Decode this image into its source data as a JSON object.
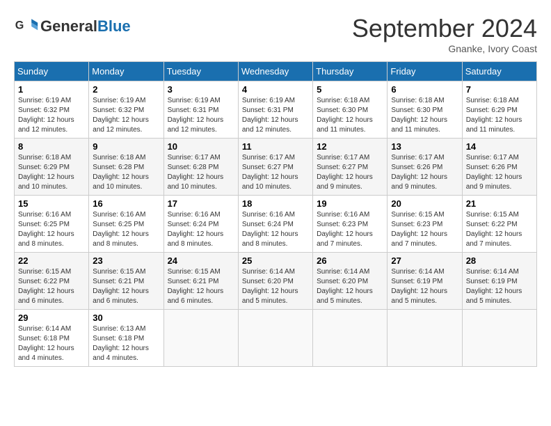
{
  "header": {
    "logo_general": "General",
    "logo_blue": "Blue",
    "month_title": "September 2024",
    "location": "Gnanke, Ivory Coast"
  },
  "days_of_week": [
    "Sunday",
    "Monday",
    "Tuesday",
    "Wednesday",
    "Thursday",
    "Friday",
    "Saturday"
  ],
  "weeks": [
    [
      {
        "day": "1",
        "sunrise": "6:19 AM",
        "sunset": "6:32 PM",
        "daylight": "12 hours and 12 minutes."
      },
      {
        "day": "2",
        "sunrise": "6:19 AM",
        "sunset": "6:32 PM",
        "daylight": "12 hours and 12 minutes."
      },
      {
        "day": "3",
        "sunrise": "6:19 AM",
        "sunset": "6:31 PM",
        "daylight": "12 hours and 12 minutes."
      },
      {
        "day": "4",
        "sunrise": "6:19 AM",
        "sunset": "6:31 PM",
        "daylight": "12 hours and 12 minutes."
      },
      {
        "day": "5",
        "sunrise": "6:18 AM",
        "sunset": "6:30 PM",
        "daylight": "12 hours and 11 minutes."
      },
      {
        "day": "6",
        "sunrise": "6:18 AM",
        "sunset": "6:30 PM",
        "daylight": "12 hours and 11 minutes."
      },
      {
        "day": "7",
        "sunrise": "6:18 AM",
        "sunset": "6:29 PM",
        "daylight": "12 hours and 11 minutes."
      }
    ],
    [
      {
        "day": "8",
        "sunrise": "6:18 AM",
        "sunset": "6:29 PM",
        "daylight": "12 hours and 10 minutes."
      },
      {
        "day": "9",
        "sunrise": "6:18 AM",
        "sunset": "6:28 PM",
        "daylight": "12 hours and 10 minutes."
      },
      {
        "day": "10",
        "sunrise": "6:17 AM",
        "sunset": "6:28 PM",
        "daylight": "12 hours and 10 minutes."
      },
      {
        "day": "11",
        "sunrise": "6:17 AM",
        "sunset": "6:27 PM",
        "daylight": "12 hours and 10 minutes."
      },
      {
        "day": "12",
        "sunrise": "6:17 AM",
        "sunset": "6:27 PM",
        "daylight": "12 hours and 9 minutes."
      },
      {
        "day": "13",
        "sunrise": "6:17 AM",
        "sunset": "6:26 PM",
        "daylight": "12 hours and 9 minutes."
      },
      {
        "day": "14",
        "sunrise": "6:17 AM",
        "sunset": "6:26 PM",
        "daylight": "12 hours and 9 minutes."
      }
    ],
    [
      {
        "day": "15",
        "sunrise": "6:16 AM",
        "sunset": "6:25 PM",
        "daylight": "12 hours and 8 minutes."
      },
      {
        "day": "16",
        "sunrise": "6:16 AM",
        "sunset": "6:25 PM",
        "daylight": "12 hours and 8 minutes."
      },
      {
        "day": "17",
        "sunrise": "6:16 AM",
        "sunset": "6:24 PM",
        "daylight": "12 hours and 8 minutes."
      },
      {
        "day": "18",
        "sunrise": "6:16 AM",
        "sunset": "6:24 PM",
        "daylight": "12 hours and 8 minutes."
      },
      {
        "day": "19",
        "sunrise": "6:16 AM",
        "sunset": "6:23 PM",
        "daylight": "12 hours and 7 minutes."
      },
      {
        "day": "20",
        "sunrise": "6:15 AM",
        "sunset": "6:23 PM",
        "daylight": "12 hours and 7 minutes."
      },
      {
        "day": "21",
        "sunrise": "6:15 AM",
        "sunset": "6:22 PM",
        "daylight": "12 hours and 7 minutes."
      }
    ],
    [
      {
        "day": "22",
        "sunrise": "6:15 AM",
        "sunset": "6:22 PM",
        "daylight": "12 hours and 6 minutes."
      },
      {
        "day": "23",
        "sunrise": "6:15 AM",
        "sunset": "6:21 PM",
        "daylight": "12 hours and 6 minutes."
      },
      {
        "day": "24",
        "sunrise": "6:15 AM",
        "sunset": "6:21 PM",
        "daylight": "12 hours and 6 minutes."
      },
      {
        "day": "25",
        "sunrise": "6:14 AM",
        "sunset": "6:20 PM",
        "daylight": "12 hours and 5 minutes."
      },
      {
        "day": "26",
        "sunrise": "6:14 AM",
        "sunset": "6:20 PM",
        "daylight": "12 hours and 5 minutes."
      },
      {
        "day": "27",
        "sunrise": "6:14 AM",
        "sunset": "6:19 PM",
        "daylight": "12 hours and 5 minutes."
      },
      {
        "day": "28",
        "sunrise": "6:14 AM",
        "sunset": "6:19 PM",
        "daylight": "12 hours and 5 minutes."
      }
    ],
    [
      {
        "day": "29",
        "sunrise": "6:14 AM",
        "sunset": "6:18 PM",
        "daylight": "12 hours and 4 minutes."
      },
      {
        "day": "30",
        "sunrise": "6:13 AM",
        "sunset": "6:18 PM",
        "daylight": "12 hours and 4 minutes."
      },
      null,
      null,
      null,
      null,
      null
    ]
  ]
}
